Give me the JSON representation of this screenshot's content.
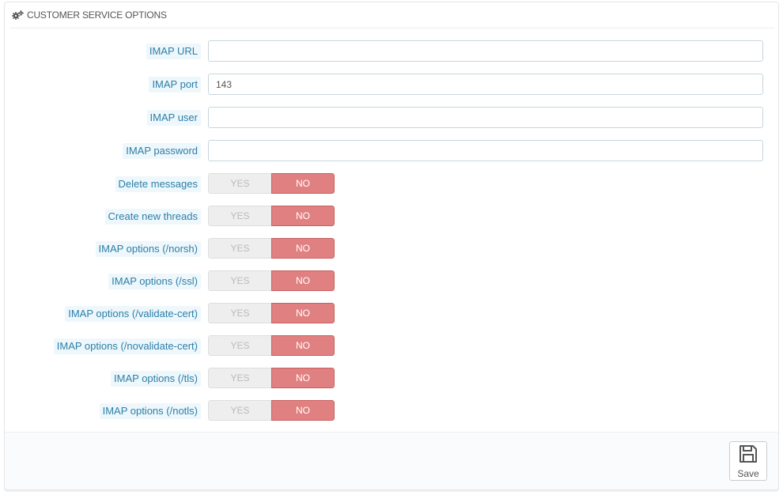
{
  "panel": {
    "title": "CUSTOMER SERVICE OPTIONS",
    "heading_icon": "cogs-icon"
  },
  "fields": {
    "imap_url": {
      "label": "IMAP URL",
      "value": "",
      "placeholder": ""
    },
    "imap_port": {
      "label": "IMAP port",
      "value": "143",
      "placeholder": ""
    },
    "imap_user": {
      "label": "IMAP user",
      "value": "",
      "placeholder": ""
    },
    "imap_password": {
      "label": "IMAP password",
      "value": "",
      "placeholder": ""
    }
  },
  "switches": [
    {
      "label": "Delete messages",
      "yes": "YES",
      "no": "NO",
      "selected": "NO"
    },
    {
      "label": "Create new threads",
      "yes": "YES",
      "no": "NO",
      "selected": "NO"
    },
    {
      "label": "IMAP options (/norsh)",
      "yes": "YES",
      "no": "NO",
      "selected": "NO"
    },
    {
      "label": "IMAP options (/ssl)",
      "yes": "YES",
      "no": "NO",
      "selected": "NO"
    },
    {
      "label": "IMAP options (/validate-cert)",
      "yes": "YES",
      "no": "NO",
      "selected": "NO"
    },
    {
      "label": "IMAP options (/novalidate-cert)",
      "yes": "YES",
      "no": "NO",
      "selected": "NO"
    },
    {
      "label": "IMAP options (/tls)",
      "yes": "YES",
      "no": "NO",
      "selected": "NO"
    },
    {
      "label": "IMAP options (/notls)",
      "yes": "YES",
      "no": "NO",
      "selected": "NO"
    }
  ],
  "footer": {
    "save_label": "Save",
    "save_icon": "floppy-disk-icon"
  },
  "colors": {
    "label_text": "#2c7fa8",
    "label_bg": "#eef7fb",
    "switch_no_bg": "#e08080",
    "switch_yes_bg": "#eeeeee"
  }
}
